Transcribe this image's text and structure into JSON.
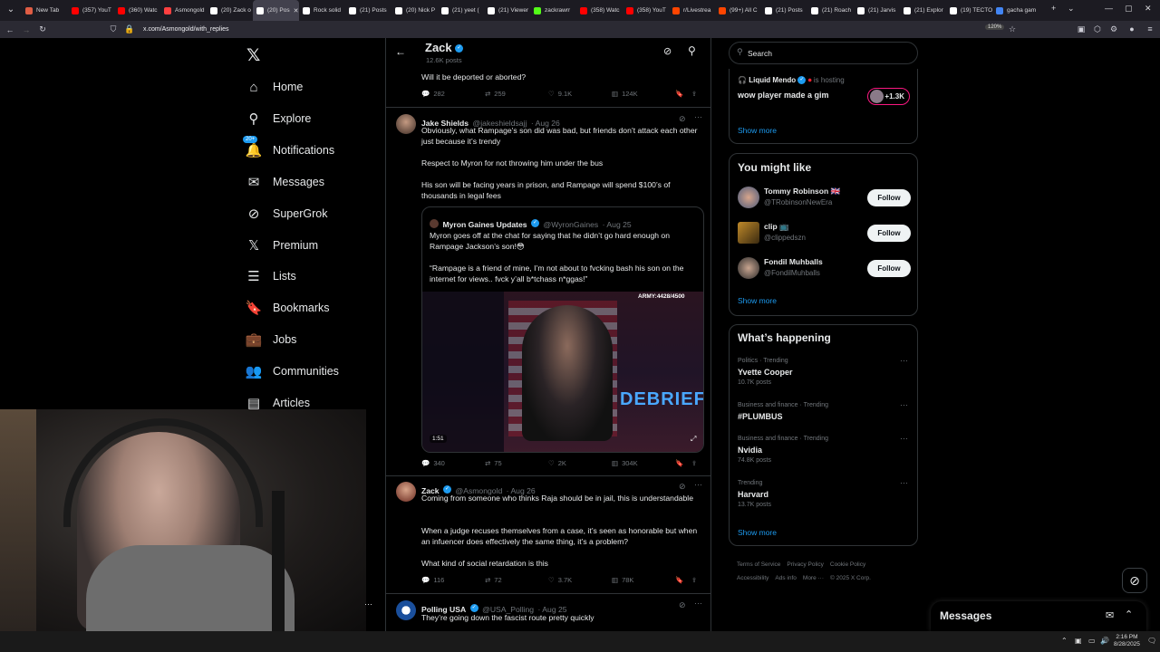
{
  "browser": {
    "tabs": [
      {
        "label": "New Tab",
        "color": "#e05d44"
      },
      {
        "label": "(357) YouT",
        "color": "#ff0000"
      },
      {
        "label": "(360) Watc",
        "color": "#ff0000"
      },
      {
        "label": "Asmongold",
        "color": "#ff4040"
      },
      {
        "label": "(20) Zack o",
        "color": "#ffffff"
      },
      {
        "label": "(20) Pos",
        "color": "#ffffff"
      },
      {
        "label": "Rock solid",
        "color": "#ffffff"
      },
      {
        "label": "(21) Posts",
        "color": "#ffffff"
      },
      {
        "label": "(20) Nick P",
        "color": "#ffffff"
      },
      {
        "label": "(21) yeet (",
        "color": "#ffffff"
      },
      {
        "label": "(21) Viewer",
        "color": "#ffffff"
      },
      {
        "label": "zackrawrr",
        "color": "#53fc18"
      },
      {
        "label": "(358) Watc",
        "color": "#ff0000"
      },
      {
        "label": "(358) YouT",
        "color": "#ff0000"
      },
      {
        "label": "r/Livestrea",
        "color": "#ff4500"
      },
      {
        "label": "(99+) All C",
        "color": "#ff4500"
      },
      {
        "label": "(21) Posts",
        "color": "#ffffff"
      },
      {
        "label": "(21) Roach",
        "color": "#ffffff"
      },
      {
        "label": "(21) Jarvis",
        "color": "#ffffff"
      },
      {
        "label": "(21) Explor",
        "color": "#ffffff"
      },
      {
        "label": "(19) TECTO",
        "color": "#ffffff"
      },
      {
        "label": "gacha gam",
        "color": "#4285f4"
      }
    ],
    "url": "x.com/Asmongold/with_replies",
    "zoom": "120%"
  },
  "sidebar": {
    "items": [
      {
        "label": "Home",
        "icon": "home-icon",
        "glyph": "⌂"
      },
      {
        "label": "Explore",
        "icon": "search-icon",
        "glyph": "⚲"
      },
      {
        "label": "Notifications",
        "icon": "bell-icon",
        "glyph": "🔔",
        "badge": "20+"
      },
      {
        "label": "Messages",
        "icon": "envelope-icon",
        "glyph": "✉"
      },
      {
        "label": "SuperGrok",
        "icon": "grok-icon",
        "glyph": "⊘"
      },
      {
        "label": "Premium",
        "icon": "x-logo-icon",
        "glyph": "𝕏"
      },
      {
        "label": "Lists",
        "icon": "list-icon",
        "glyph": "☰"
      },
      {
        "label": "Bookmarks",
        "icon": "bookmark-icon",
        "glyph": "🔖"
      },
      {
        "label": "Jobs",
        "icon": "briefcase-icon",
        "glyph": "💼"
      },
      {
        "label": "Communities",
        "icon": "people-icon",
        "glyph": "👥"
      },
      {
        "label": "Articles",
        "icon": "article-icon",
        "glyph": "▤"
      }
    ]
  },
  "header": {
    "name": "Zack",
    "posts": "12.6K posts"
  },
  "tweets": {
    "t0": {
      "text": "Will it be deported or aborted?",
      "replies": "282",
      "reposts": "259",
      "likes": "9.1K",
      "views": "124K"
    },
    "t1": {
      "name": "Jake Shields",
      "handle": "@jakeshieldsajj",
      "date": "· Aug 26",
      "p1": "Obviously, what Rampage’s son did was bad, but friends don’t attack each other just because it’s trendy",
      "p2": "Respect to Myron for not throwing him under the bus",
      "p3": "His son will be facing years in prison, and Rampage will spend $100’s of thousands in legal fees",
      "quote": {
        "name": "Myron Gaines Updates",
        "handle": "@WyronGaines",
        "date": "· Aug 25",
        "p1": "Myron goes off at the chat for saying that he didn’t go hard enough on Rampage Jackson’s son!😳",
        "p2": "“Rampage is a friend of mine, I’m not about to fvcking bash his son on the internet for views.. fvck y’all b*tchass n*ggas!”",
        "video_time": "1:51",
        "overlay": "ARMY:4428/4500",
        "overlay2": "DEBRIEF"
      },
      "replies": "340",
      "reposts": "75",
      "likes": "2K",
      "views": "304K"
    },
    "t2": {
      "name": "Zack",
      "handle": "@Asmongold",
      "date": "· Aug 26",
      "p1": "Coming from someone who thinks Raja should be in jail, this is understandable",
      "p2": "When a judge recuses themselves from a case, it’s seen as honorable but when an infuencer does effectively the same thing, it’s a problem?",
      "p3": "What kind of social retardation is this",
      "replies": "116",
      "reposts": "72",
      "likes": "3.7K",
      "views": "78K"
    },
    "t3": {
      "name": "Polling USA",
      "handle": "@USA_Polling",
      "date": "· Aug 25",
      "p1": "They’re going down the fascist route pretty quickly"
    }
  },
  "right": {
    "search_placeholder": "Search",
    "live": {
      "host": "Liquid Mendo",
      "hosting": "is hosting",
      "title": "wow player made a gim",
      "count": "+1.3K",
      "show_more": "Show more"
    },
    "you_might_like": {
      "title": "You might like",
      "people": [
        {
          "name": "Tommy Robinson 🇬🇧",
          "handle": "@TRobinsonNewEra",
          "button": "Follow"
        },
        {
          "name": "clip 📺",
          "handle": "@clippedszn",
          "button": "Follow"
        },
        {
          "name": "Fondil Muhballs",
          "handle": "@FondilMuhballs",
          "button": "Follow"
        }
      ],
      "show_more": "Show more"
    },
    "happening": {
      "title": "What’s happening",
      "trends": [
        {
          "cat": "Politics · Trending",
          "name": "Yvette Cooper",
          "count": "10.7K posts"
        },
        {
          "cat": "Business and finance · Trending",
          "name": "#PLUMBUS",
          "count": ""
        },
        {
          "cat": "Business and finance · Trending",
          "name": "Nvidia",
          "count": "74.8K posts"
        },
        {
          "cat": "Trending",
          "name": "Harvard",
          "count": "13.7K posts"
        }
      ],
      "show_more": "Show more"
    },
    "footer": [
      "Terms of Service",
      "Privacy Policy",
      "Cookie Policy",
      "Accessibility",
      "Ads info",
      "More ···",
      "© 2025 X Corp."
    ],
    "messages": "Messages"
  },
  "taskbar": {
    "time": "2:16 PM",
    "date": "8/28/2025"
  }
}
